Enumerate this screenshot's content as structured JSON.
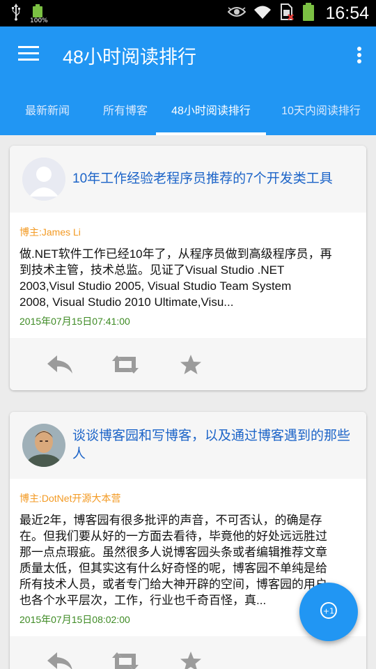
{
  "status_bar": {
    "battery_percent": "100%",
    "time": "16:54",
    "icons": [
      "usb-icon",
      "battery-small-icon",
      "eye-icon",
      "wifi-icon",
      "sim-icon",
      "battery-icon"
    ]
  },
  "app_bar": {
    "title": "48小时阅读排行",
    "menu_icon": "hamburger-menu-icon",
    "overflow_icon": "overflow-menu-icon"
  },
  "tabs": [
    {
      "label": "最新新闻",
      "active": false
    },
    {
      "label": "所有博客",
      "active": false
    },
    {
      "label": "48小时阅读排行",
      "active": true
    },
    {
      "label": "10天内阅读排行",
      "active": false
    }
  ],
  "posts": [
    {
      "title": "10年工作经验老程序员推荐的7个开发类工具",
      "author": "博主:James Li",
      "summary_lines": [
        "做.NET软件工作已经10年了，从程序员做到高级程序员，再",
        "到技术主管，技术总监。见证了Visual Studio .NET",
        "2003,Visul Studio 2005, Visual Studio Team System",
        "2008, Visual Studio 2010 Ultimate,Visu..."
      ],
      "date": "2015年07月15日07:41:00",
      "avatar": "default-avatar"
    },
    {
      "title_lines": [
        "谈谈博客园和写博客，以及通过博客遇到的那些",
        "人"
      ],
      "author": "博主:DotNet开源大本营",
      "summary_lines": [
        "最近2年，博客园有很多批评的声音，不可否认，的确是存",
        "在。但我们要从好的一方面去看待，毕竟他的好处远远胜过",
        "那一点点瑕疵。虽然很多人说博客园头条或者编辑推荐文章",
        "质量太低，但其实这有什么好奇怪的呢，博客园不单纯是给",
        "所有技术人员，或者专门给大神开辟的空间，博客园的用户",
        "也各个水平层次，工作，行业也千奇百怪，真..."
      ],
      "date": "2015年07月15日08:02:00",
      "avatar": "portrait-avatar"
    }
  ],
  "actions": [
    "reply-icon",
    "repost-icon",
    "star-icon"
  ],
  "fab": {
    "icon": "plus-one-icon",
    "label": "+1"
  },
  "colors": {
    "primary": "#2196f3",
    "title": "#1c64c8",
    "author": "#f39a23",
    "date": "#3d8a23"
  }
}
